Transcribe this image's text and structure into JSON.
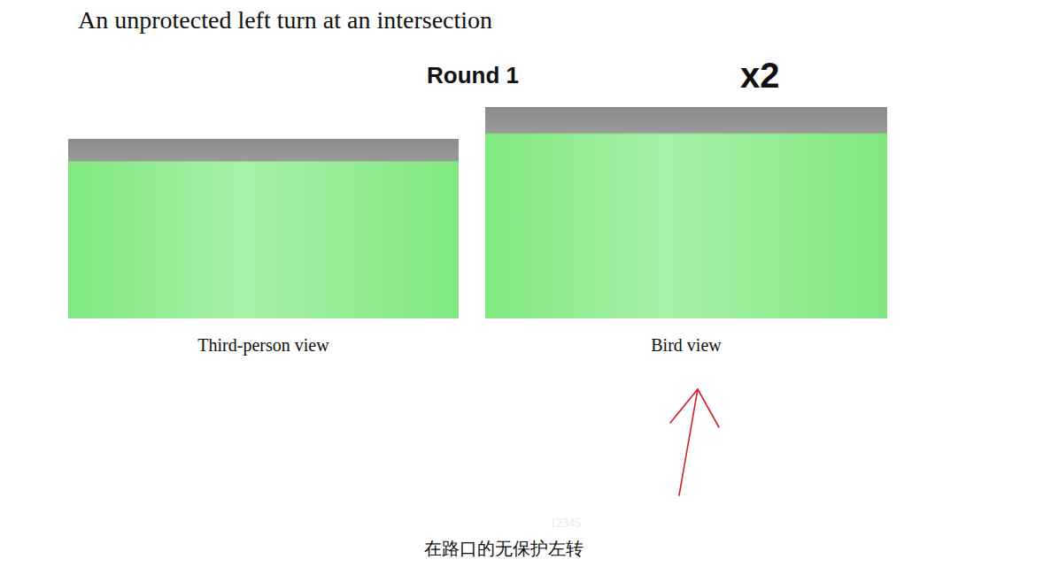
{
  "slide": {
    "title": "An unprotected left turn at an intersection",
    "round": "Round 1",
    "speed": "x2"
  },
  "figures": [
    {
      "caption": "Third-person view"
    },
    {
      "caption": "Bird view"
    }
  ],
  "watermark": "12345",
  "subtitle": "在路口的无保护左转"
}
